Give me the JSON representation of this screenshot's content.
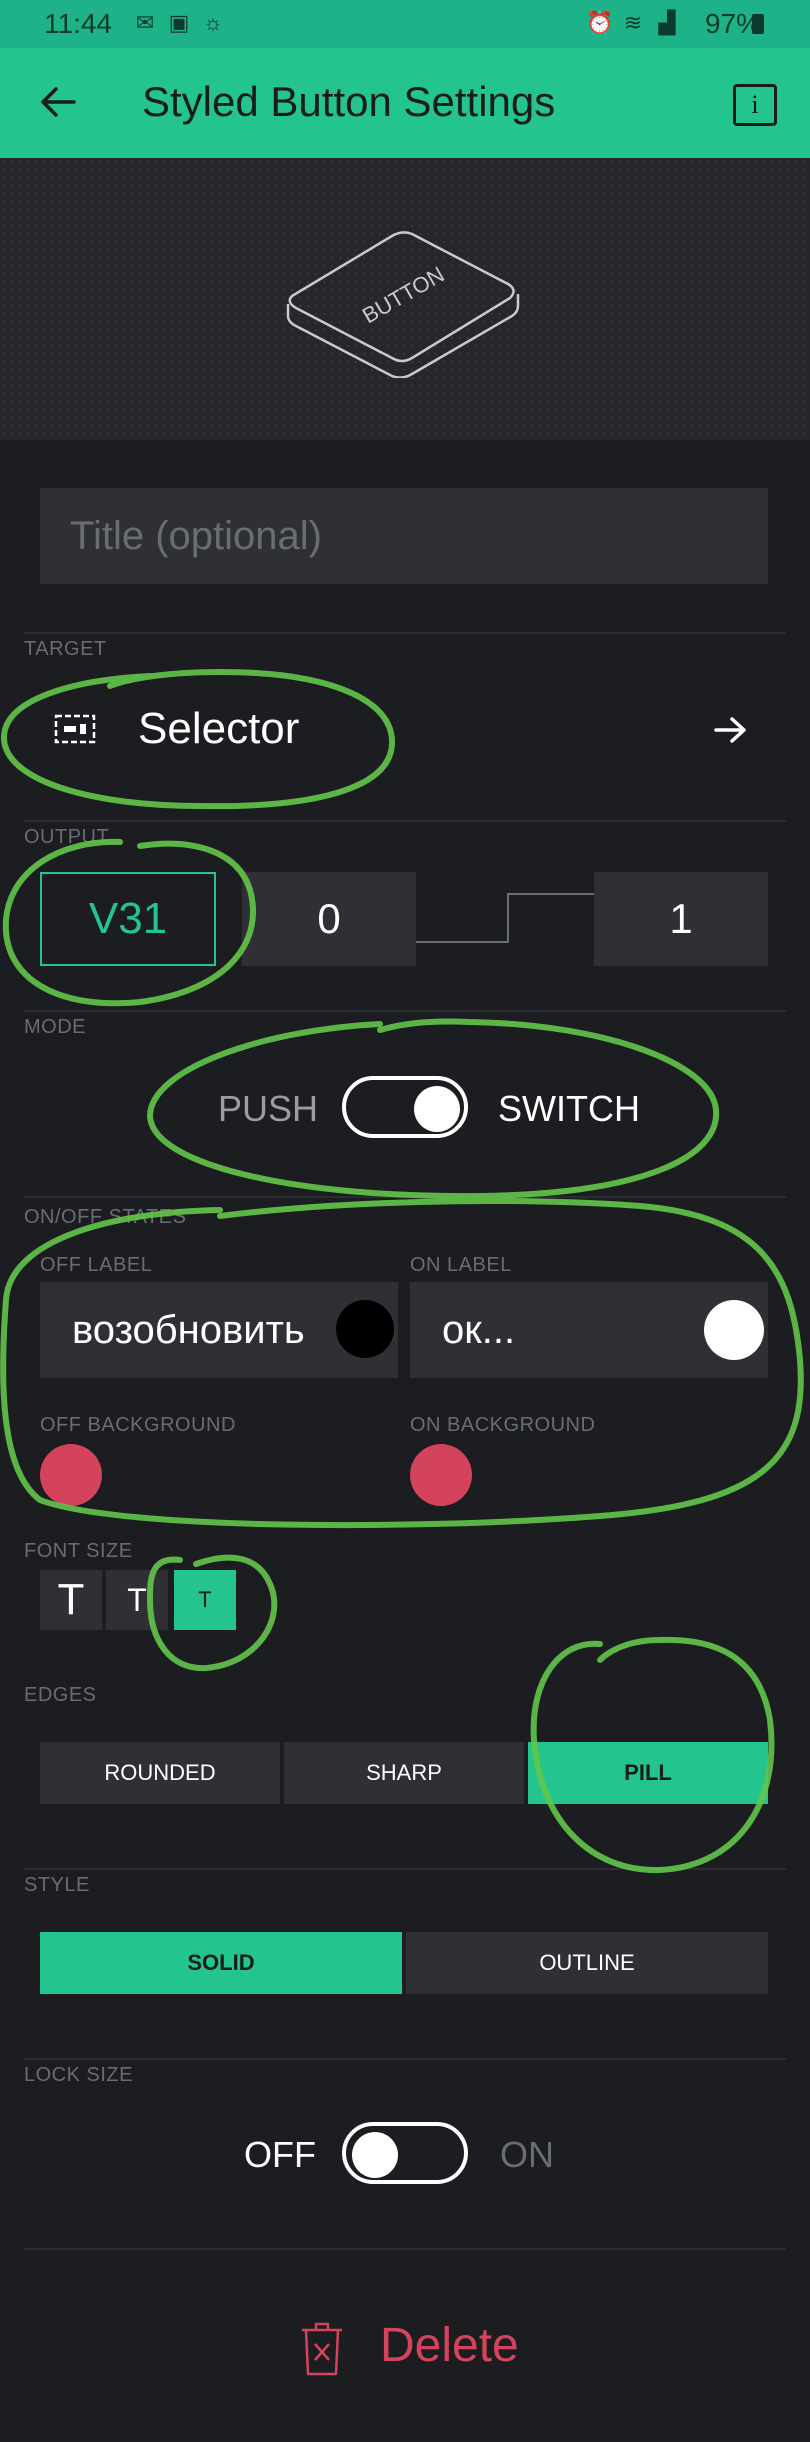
{
  "status": {
    "time": "11:44",
    "battery": "97%"
  },
  "appbar": {
    "title": "Styled Button Settings",
    "info_glyph": "i"
  },
  "preview": {
    "button_text": "BUTTON"
  },
  "title_field": {
    "placeholder": "Title (optional)",
    "value": ""
  },
  "target": {
    "label": "TARGET",
    "value": "Selector"
  },
  "output": {
    "label": "OUTPUT",
    "pin": "V31",
    "min": "0",
    "max": "1"
  },
  "mode": {
    "label": "MODE",
    "push": "PUSH",
    "switch": "SWITCH",
    "selected": "SWITCH"
  },
  "states": {
    "label": "ON/OFF STATES",
    "off_label_title": "OFF LABEL",
    "on_label_title": "ON LABEL",
    "off_label_value": "возобновить",
    "on_label_value": "ок...",
    "off_text_color": "#000000",
    "on_text_color": "#ffffff",
    "off_background_title": "OFF BACKGROUND",
    "on_background_title": "ON BACKGROUND",
    "off_background_color": "#d3435c",
    "on_background_color": "#d3435c"
  },
  "font_size": {
    "label": "FONT SIZE",
    "options": [
      "T",
      "T",
      "T"
    ],
    "selected_index": 2
  },
  "edges": {
    "label": "EDGES",
    "options": [
      "ROUNDED",
      "SHARP",
      "PILL"
    ],
    "selected": "PILL"
  },
  "style": {
    "label": "STYLE",
    "options": [
      "SOLID",
      "OUTLINE"
    ],
    "selected": "SOLID"
  },
  "lock_size": {
    "label": "LOCK SIZE",
    "off": "OFF",
    "on": "ON",
    "state": "OFF"
  },
  "delete": {
    "label": "Delete"
  },
  "colors": {
    "accent": "#23c48e",
    "danger": "#d3435c",
    "background": "#1c1d21",
    "field": "#2e3035"
  }
}
